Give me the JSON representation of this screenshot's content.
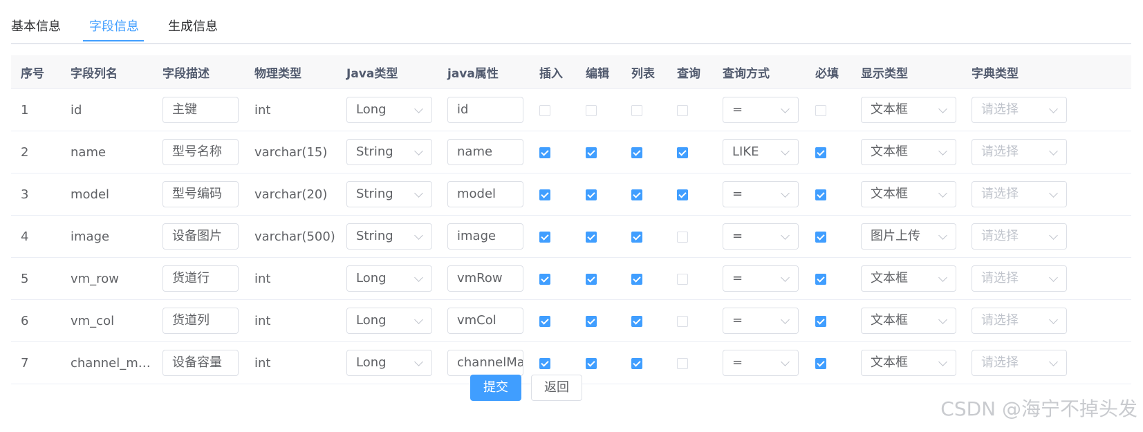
{
  "tabs": [
    "基本信息",
    "字段信息",
    "生成信息"
  ],
  "active_tab": 1,
  "columns": [
    "序号",
    "字段列名",
    "字段描述",
    "物理类型",
    "Java类型",
    "java属性",
    "插入",
    "编辑",
    "列表",
    "查询",
    "查询方式",
    "必填",
    "显示类型",
    "字典类型"
  ],
  "rows": [
    {
      "no": "1",
      "col": "id",
      "desc": "主键",
      "ptype": "int",
      "jtype": "Long",
      "jprop": "id",
      "insert": false,
      "edit": false,
      "list": false,
      "query": false,
      "qtype": "=",
      "required": false,
      "display": "文本框"
    },
    {
      "no": "2",
      "col": "name",
      "desc": "型号名称",
      "ptype": "varchar(15)",
      "jtype": "String",
      "jprop": "name",
      "insert": true,
      "edit": true,
      "list": true,
      "query": true,
      "qtype": "LIKE",
      "required": true,
      "display": "文本框"
    },
    {
      "no": "3",
      "col": "model",
      "desc": "型号编码",
      "ptype": "varchar(20)",
      "jtype": "String",
      "jprop": "model",
      "insert": true,
      "edit": true,
      "list": true,
      "query": true,
      "qtype": "=",
      "required": true,
      "display": "文本框"
    },
    {
      "no": "4",
      "col": "image",
      "desc": "设备图片",
      "ptype": "varchar(500)",
      "jtype": "String",
      "jprop": "image",
      "insert": true,
      "edit": true,
      "list": true,
      "query": false,
      "qtype": "=",
      "required": true,
      "display": "图片上传"
    },
    {
      "no": "5",
      "col": "vm_row",
      "desc": "货道行",
      "ptype": "int",
      "jtype": "Long",
      "jprop": "vmRow",
      "insert": true,
      "edit": true,
      "list": true,
      "query": false,
      "qtype": "=",
      "required": true,
      "display": "文本框"
    },
    {
      "no": "6",
      "col": "vm_col",
      "desc": "货道列",
      "ptype": "int",
      "jtype": "Long",
      "jprop": "vmCol",
      "insert": true,
      "edit": true,
      "list": true,
      "query": false,
      "qtype": "=",
      "required": true,
      "display": "文本框"
    },
    {
      "no": "7",
      "col": "channel_m…",
      "desc": "设备容量",
      "ptype": "int",
      "jtype": "Long",
      "jprop": "channelMa",
      "insert": true,
      "edit": true,
      "list": true,
      "query": false,
      "qtype": "=",
      "required": true,
      "display": "文本框"
    }
  ],
  "dict_placeholder": "请选择",
  "buttons": {
    "submit": "提交",
    "back": "返回"
  },
  "watermark": "CSDN @海宁不掉头发",
  "colors": {
    "primary": "#409eff",
    "border": "#dcdfe6",
    "header_bg": "#f8f8f9"
  }
}
